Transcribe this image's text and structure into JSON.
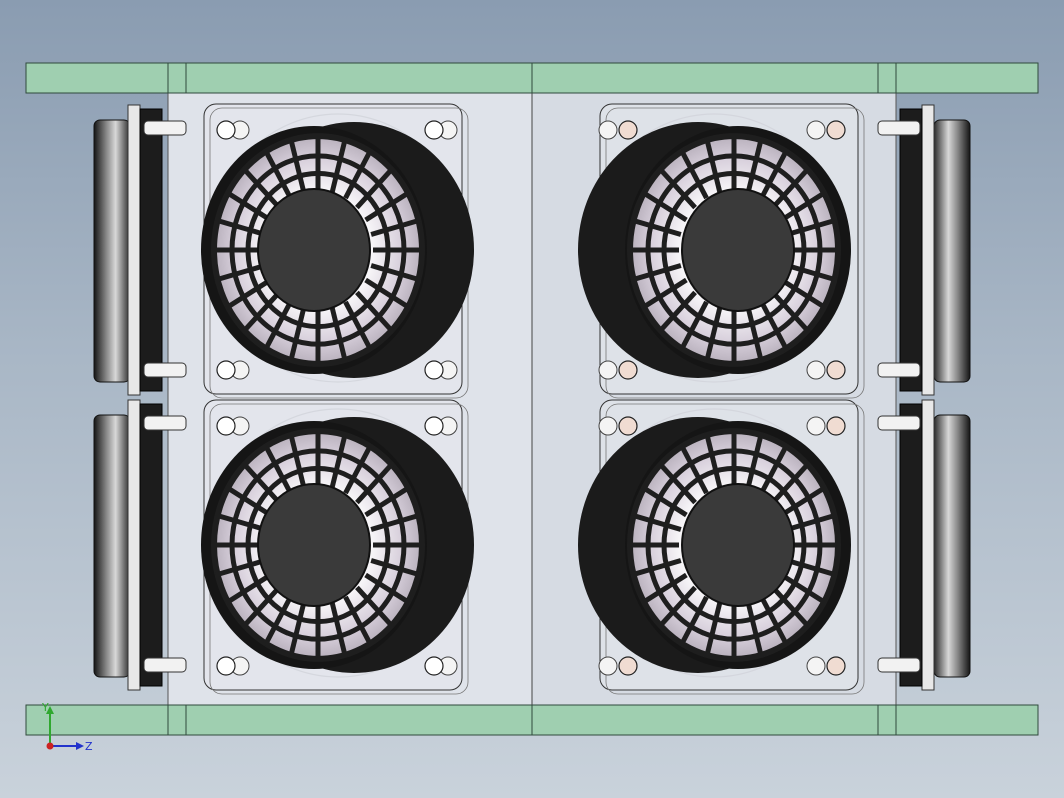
{
  "viewport": {
    "background_top": "#8a9cb1",
    "background_bottom": "#c9d2db"
  },
  "model": {
    "rail_color": "#9fcfb0",
    "rail_edge_color": "#2f4a3c",
    "panel_color": "#dfe3ea",
    "fan_frame_color": "#e6e8ec",
    "fan_grille_color": "#1e1e1e",
    "fan_hub_color": "#3a3a3a",
    "bushing_color": "#f0dcd2",
    "fans": [
      {
        "name": "fan-top-left",
        "orientation": "left"
      },
      {
        "name": "fan-top-right",
        "orientation": "right"
      },
      {
        "name": "fan-bottom-left",
        "orientation": "left"
      },
      {
        "name": "fan-bottom-right",
        "orientation": "right"
      }
    ],
    "side_fans": [
      {
        "name": "side-fan-left-top",
        "side": "left"
      },
      {
        "name": "side-fan-left-bottom",
        "side": "left"
      },
      {
        "name": "side-fan-right-top",
        "side": "right"
      },
      {
        "name": "side-fan-right-bottom",
        "side": "right"
      }
    ]
  },
  "triad": {
    "y_label": "Y",
    "z_label": "Z",
    "y_color": "#2fa82f",
    "z_color": "#2233cc",
    "x_color": "#cc2222"
  }
}
